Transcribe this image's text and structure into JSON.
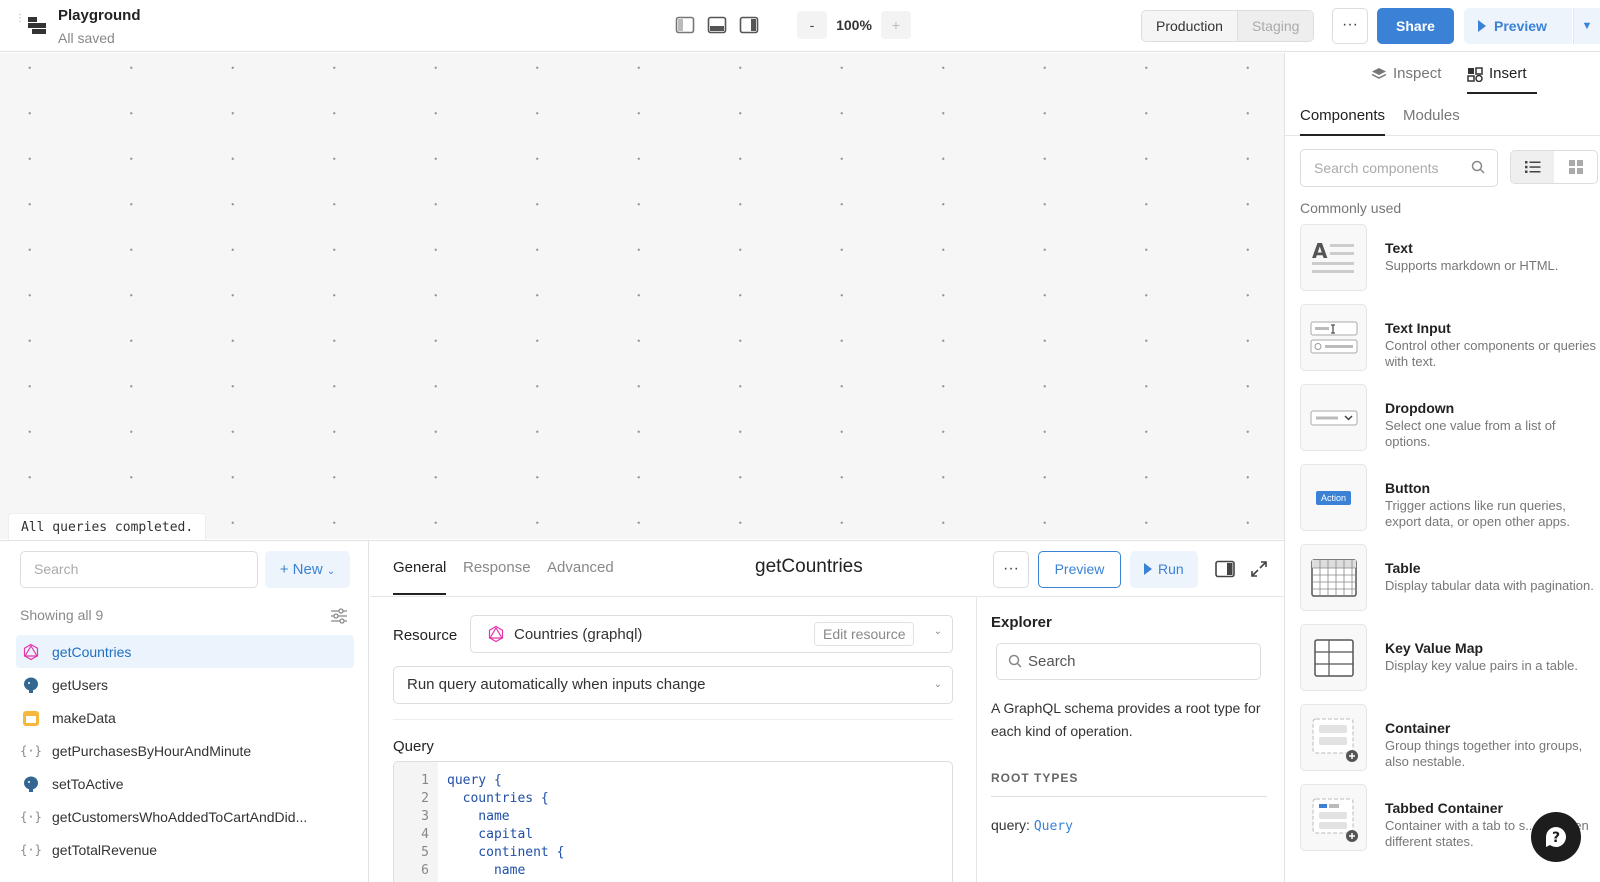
{
  "app": {
    "title": "Playground",
    "status": "All saved"
  },
  "zoom": {
    "minus": "-",
    "value": "100%",
    "plus": "+"
  },
  "env": {
    "production": "Production",
    "staging": "Staging"
  },
  "toolbar": {
    "more": "···",
    "share": "Share",
    "preview": "Preview"
  },
  "canvas": {
    "status_message": "All queries completed."
  },
  "right_panel": {
    "tabs": {
      "inspect": "Inspect",
      "insert": "Insert"
    },
    "subtabs": {
      "components": "Components",
      "modules": "Modules"
    },
    "search_placeholder": "Search components",
    "section_title": "Commonly used",
    "components": [
      {
        "name": "Text",
        "desc": "Supports markdown or HTML."
      },
      {
        "name": "Text Input",
        "desc": "Control other components or queries with text."
      },
      {
        "name": "Dropdown",
        "desc": "Select one value from a list of options."
      },
      {
        "name": "Button",
        "desc": "Trigger actions like run queries, export data, or open other apps.",
        "badge": "Action"
      },
      {
        "name": "Table",
        "desc": "Display tabular data with pagination."
      },
      {
        "name": "Key Value Map",
        "desc": "Display key value pairs in a table."
      },
      {
        "name": "Container",
        "desc": "Group things together into groups, also nestable."
      },
      {
        "name": "Tabbed Container",
        "desc": "Container with a tab to s... between different states."
      }
    ]
  },
  "query_list": {
    "search_placeholder": "Search",
    "new_label": "+ New",
    "count_label": "Showing all 9",
    "items": [
      {
        "name": "getCountries",
        "icon": "graphql-icon",
        "selected": true
      },
      {
        "name": "getUsers",
        "icon": "postgres-icon"
      },
      {
        "name": "makeData",
        "icon": "calendar-icon"
      },
      {
        "name": "getPurchasesByHourAndMinute",
        "icon": "js-braces-icon"
      },
      {
        "name": "setToActive",
        "icon": "postgres-icon"
      },
      {
        "name": "getCustomersWhoAddedToCartAndDid...",
        "icon": "js-braces-icon"
      },
      {
        "name": "getTotalRevenue",
        "icon": "js-braces-icon"
      }
    ]
  },
  "query_editor": {
    "tabs": {
      "general": "General",
      "response": "Response",
      "advanced": "Advanced"
    },
    "title": "getCountries",
    "more": "···",
    "preview": "Preview",
    "run": "Run",
    "resource_label": "Resource",
    "resource_name": "Countries (graphql)",
    "edit_resource": "Edit resource",
    "run_mode": "Run query automatically when inputs change",
    "query_label": "Query",
    "code_lines": [
      {
        "n": "1",
        "text": "query {"
      },
      {
        "n": "2",
        "text": "  countries {"
      },
      {
        "n": "3",
        "text": "    name"
      },
      {
        "n": "4",
        "text": "    capital"
      },
      {
        "n": "5",
        "text": "    continent {"
      },
      {
        "n": "6",
        "text": "      name"
      }
    ]
  },
  "explorer": {
    "title": "Explorer",
    "search_placeholder": "Search",
    "description": "A GraphQL schema provides a root type for each kind of operation.",
    "root_types_label": "ROOT TYPES",
    "root_query_key": "query: ",
    "root_query_value": "Query"
  },
  "colors": {
    "accent": "#3b82d6",
    "selected_bg": "#ebf3fc"
  }
}
